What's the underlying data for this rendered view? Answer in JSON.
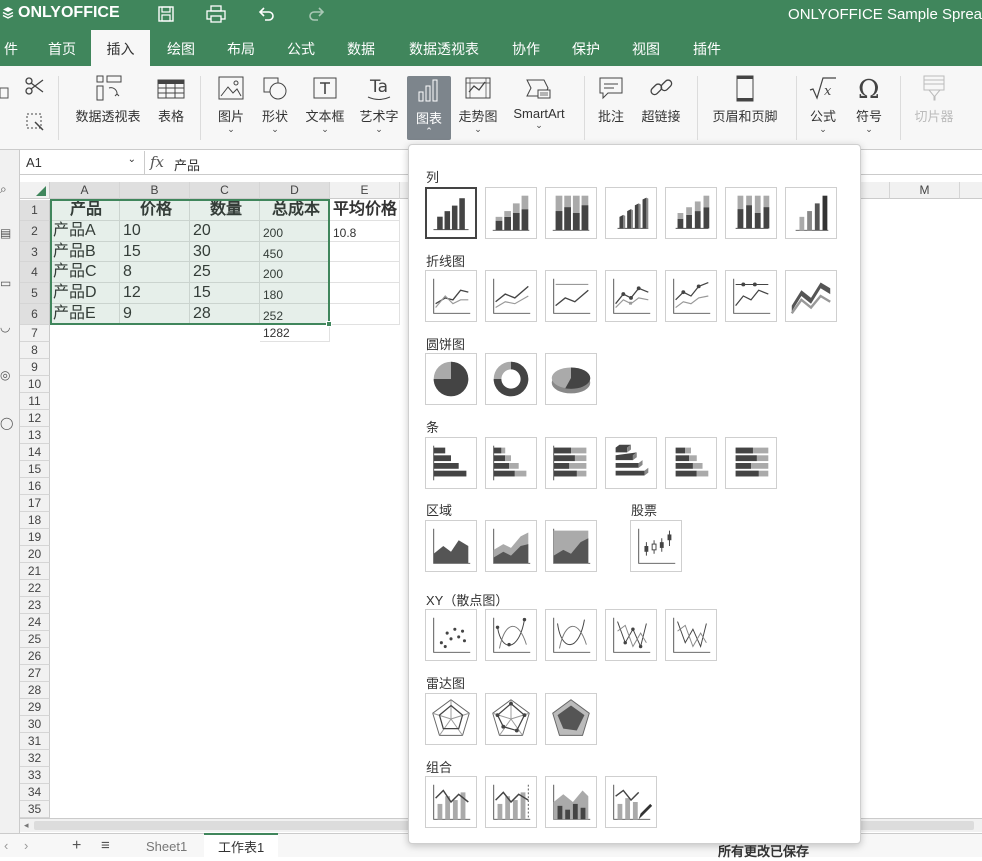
{
  "app": {
    "logo": "ONLYOFFICE",
    "doc_title": "ONLYOFFICE Sample Sprea"
  },
  "tabs": [
    "件",
    "首页",
    "插入",
    "绘图",
    "布局",
    "公式",
    "数据",
    "数据透视表",
    "协作",
    "保护",
    "视图",
    "插件"
  ],
  "active_tab": "插入",
  "toolbar": {
    "pivot": "数据透视表",
    "table": "表格",
    "image": "图片",
    "shape": "形状",
    "textbox": "文本框",
    "textart": "艺术字",
    "chart": "图表",
    "sparkline": "走势图",
    "smartart": "SmartArt",
    "comment": "批注",
    "hyperlink": "超链接",
    "header_footer": "页眉和页脚",
    "formula": "公式",
    "symbol": "符号",
    "slicer": "切片器"
  },
  "formula_bar": {
    "name_box": "A1",
    "fx": "fx",
    "value": "产品"
  },
  "grid": {
    "columns": [
      "A",
      "B",
      "C",
      "D",
      "E",
      "M"
    ],
    "rows": [
      "1",
      "2",
      "3",
      "4",
      "5",
      "6",
      "7",
      "8",
      "9",
      "10",
      "11",
      "12",
      "13",
      "14",
      "15",
      "16",
      "17",
      "18",
      "19",
      "20",
      "21",
      "22",
      "23",
      "24",
      "25",
      "26",
      "27",
      "28",
      "29",
      "30",
      "31",
      "32",
      "33",
      "34",
      "35"
    ],
    "header_row": [
      "产品",
      "价格",
      "数量",
      "总成本",
      "平均价格"
    ],
    "data": [
      [
        "产品A",
        "10",
        "20",
        "200",
        "10.8"
      ],
      [
        "产品B",
        "15",
        "30",
        "450",
        ""
      ],
      [
        "产品C",
        "8",
        "25",
        "200",
        ""
      ],
      [
        "产品D",
        "12",
        "15",
        "180",
        ""
      ],
      [
        "产品E",
        "9",
        "28",
        "252",
        ""
      ]
    ],
    "total": "1282"
  },
  "sheets": [
    "Sheet1",
    "工作表1"
  ],
  "active_sheet": "工作表1",
  "status": "所有更改已保存",
  "chart_panel": {
    "sections": {
      "column": "列",
      "line": "折线图",
      "pie": "圆饼图",
      "bar": "条",
      "area": "区域",
      "stock": "股票",
      "scatter": "XY（散点图）",
      "radar": "雷达图",
      "combo": "组合"
    }
  },
  "colors": {
    "brand": "#40865c",
    "active_button": "#7d858c"
  }
}
